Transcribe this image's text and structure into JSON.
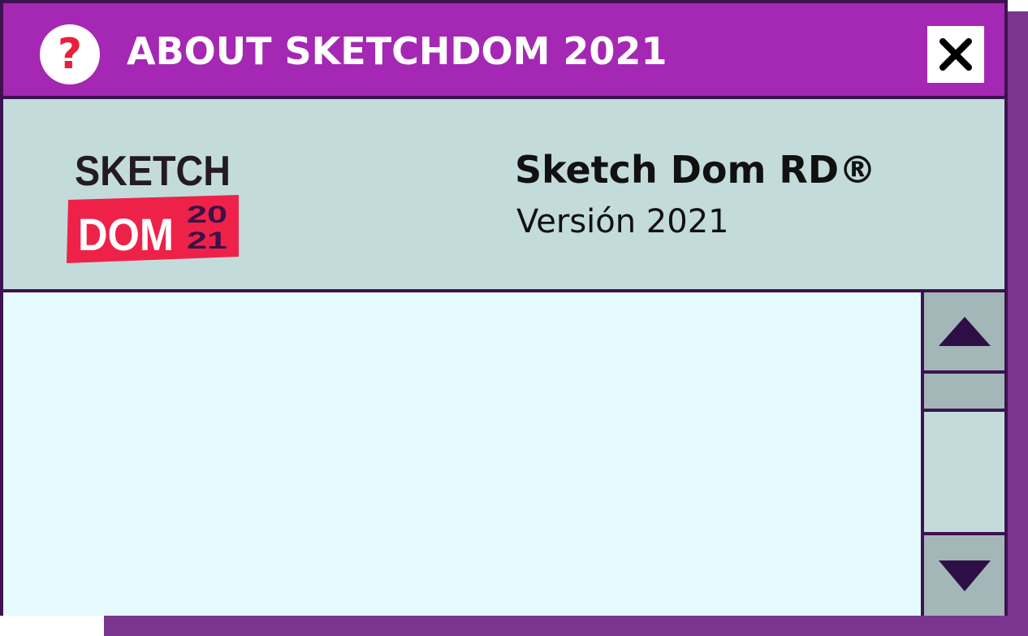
{
  "window": {
    "title": "ABOUT SKETCHDOM 2021",
    "help_icon_glyph": "?",
    "help_icon": "question-icon",
    "close_icon": "close-icon"
  },
  "logo": {
    "line1": "SKETCH",
    "line2": "DOM",
    "year_top": "20",
    "year_bottom": "21"
  },
  "app": {
    "name": "Sketch Dom RD®",
    "version": "Versión 2021"
  },
  "scrollbar": {
    "up_icon": "arrow-up-icon",
    "down_icon": "arrow-down-icon"
  },
  "colors": {
    "titlebar": "#a428b3",
    "border": "#3d1250",
    "header_bg": "#c3dcdb",
    "content_bg": "#e6fbff",
    "accent_red": "#e8203d",
    "shadow": "#7a358f"
  }
}
